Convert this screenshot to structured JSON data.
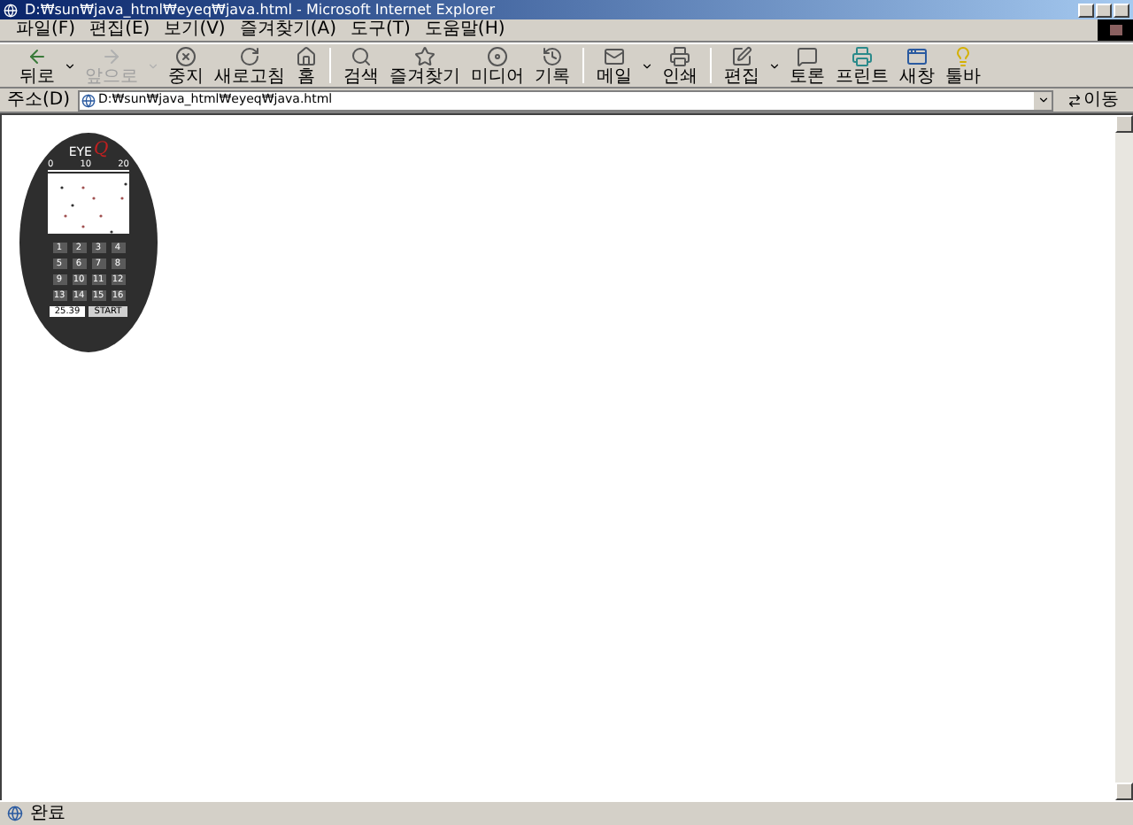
{
  "window": {
    "title": "D:₩sun₩java_html₩eyeq₩java.html - Microsoft Internet Explorer"
  },
  "menu": [
    "파일(F)",
    "편집(E)",
    "보기(V)",
    "즐겨찾기(A)",
    "도구(T)",
    "도움말(H)"
  ],
  "toolbar": [
    {
      "kind": "back",
      "label": "뒤로",
      "disabled": false,
      "dropdown": true
    },
    {
      "kind": "forward",
      "label": "앞으로",
      "disabled": true,
      "dropdown": true
    },
    {
      "kind": "stop",
      "label": "중지",
      "disabled": false,
      "dropdown": false
    },
    {
      "kind": "refresh",
      "label": "새로고침",
      "disabled": false,
      "dropdown": false
    },
    {
      "kind": "home",
      "label": "홈",
      "disabled": false,
      "dropdown": false
    },
    {
      "kind": "separator"
    },
    {
      "kind": "search",
      "label": "검색",
      "disabled": false,
      "dropdown": false
    },
    {
      "kind": "favorites",
      "label": "즐겨찾기",
      "disabled": false,
      "dropdown": false
    },
    {
      "kind": "media",
      "label": "미디어",
      "disabled": false,
      "dropdown": false
    },
    {
      "kind": "history",
      "label": "기록",
      "disabled": false,
      "dropdown": false
    },
    {
      "kind": "separator"
    },
    {
      "kind": "mail",
      "label": "메일",
      "disabled": false,
      "dropdown": true
    },
    {
      "kind": "print",
      "label": "인쇄",
      "disabled": false,
      "dropdown": false
    },
    {
      "kind": "separator"
    },
    {
      "kind": "edit",
      "label": "편집",
      "disabled": false,
      "dropdown": true
    },
    {
      "kind": "discuss",
      "label": "토론",
      "disabled": false,
      "dropdown": false
    },
    {
      "kind": "print2",
      "label": "프린트",
      "disabled": false,
      "dropdown": false
    },
    {
      "kind": "window",
      "label": "새창",
      "disabled": false,
      "dropdown": false
    },
    {
      "kind": "bulb",
      "label": "툴바",
      "disabled": false,
      "dropdown": false
    }
  ],
  "address_bar": {
    "label": "주소(D)",
    "value": "D:₩sun₩java_html₩eyeq₩java.html",
    "go": "이동"
  },
  "game": {
    "logo": "EYE",
    "logo_mark": "Q",
    "ruler": [
      "0",
      "10",
      "20"
    ],
    "keys": [
      "1",
      "2",
      "3",
      "4",
      "5",
      "6",
      "7",
      "8",
      "9",
      "10",
      "11",
      "12",
      "13",
      "14",
      "15",
      "16"
    ],
    "time": "25.39",
    "start": "START"
  },
  "status_bar": {
    "text": "완료"
  }
}
